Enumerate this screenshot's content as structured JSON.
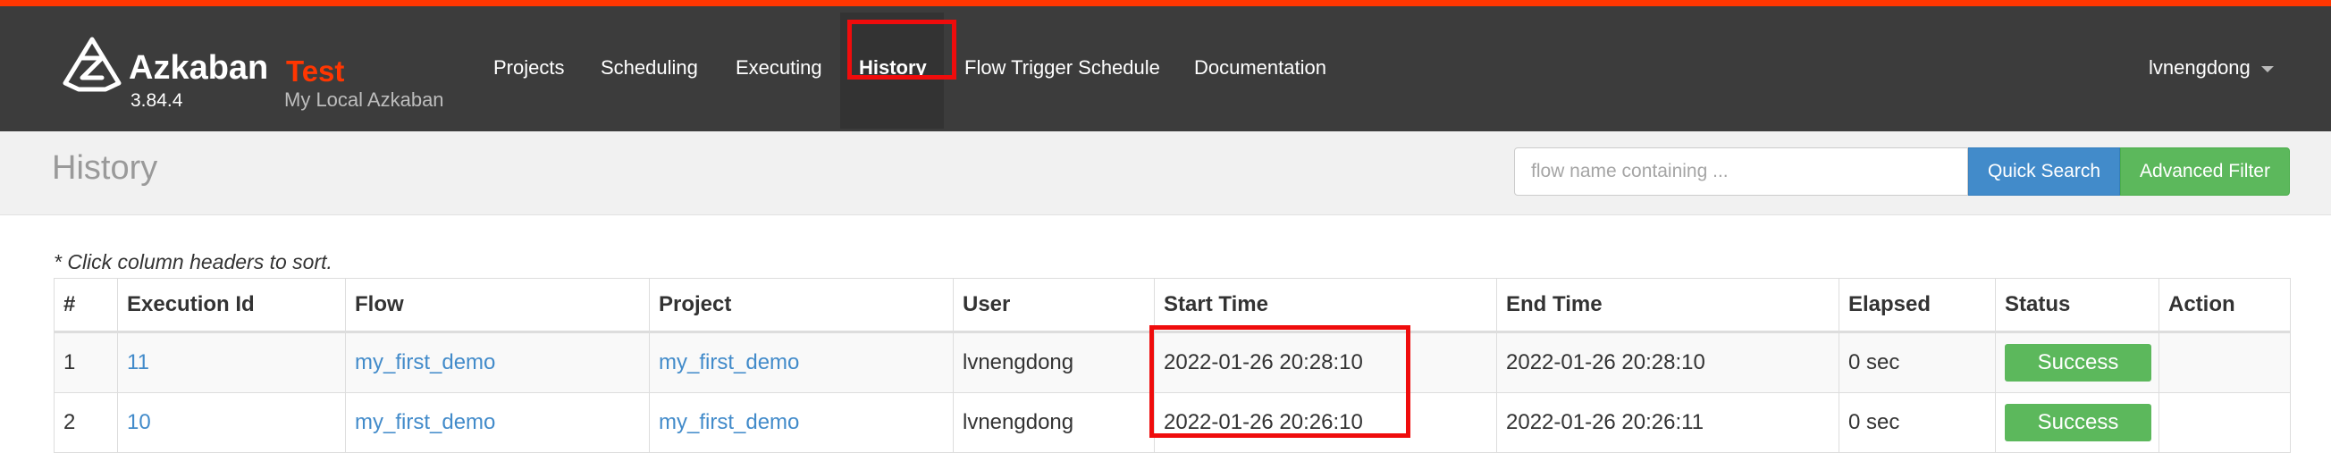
{
  "brand": {
    "name": "Azkaban",
    "env": "Test",
    "version": "3.84.4",
    "subtitle": "My Local Azkaban"
  },
  "nav": {
    "items": [
      "Projects",
      "Scheduling",
      "Executing",
      "History",
      "Flow Trigger Schedule",
      "Documentation"
    ],
    "active": "History"
  },
  "user": {
    "name": "lvnengdong"
  },
  "header": {
    "title": "History",
    "search_placeholder": "flow name containing ...",
    "quick_search_label": "Quick Search",
    "advanced_filter_label": "Advanced Filter"
  },
  "table": {
    "note": "* Click column headers to sort.",
    "columns": [
      "#",
      "Execution Id",
      "Flow",
      "Project",
      "User",
      "Start Time",
      "End Time",
      "Elapsed",
      "Status",
      "Action"
    ],
    "rows": [
      {
        "num": "1",
        "exec_id": "11",
        "flow": "my_first_demo",
        "project": "my_first_demo",
        "user": "lvnengdong",
        "start": "2022-01-26 20:28:10",
        "end": "2022-01-26 20:28:10",
        "elapsed": "0 sec",
        "status": "Success",
        "action": ""
      },
      {
        "num": "2",
        "exec_id": "10",
        "flow": "my_first_demo",
        "project": "my_first_demo",
        "user": "lvnengdong",
        "start": "2022-01-26 20:26:10",
        "end": "2022-01-26 20:26:11",
        "elapsed": "0 sec",
        "status": "Success",
        "action": ""
      }
    ]
  },
  "colors": {
    "accent": "#ff3601",
    "navbar": "#3c3c3c",
    "link": "#428bca",
    "success": "#5cb85c",
    "highlight": "#ef0c0c"
  }
}
